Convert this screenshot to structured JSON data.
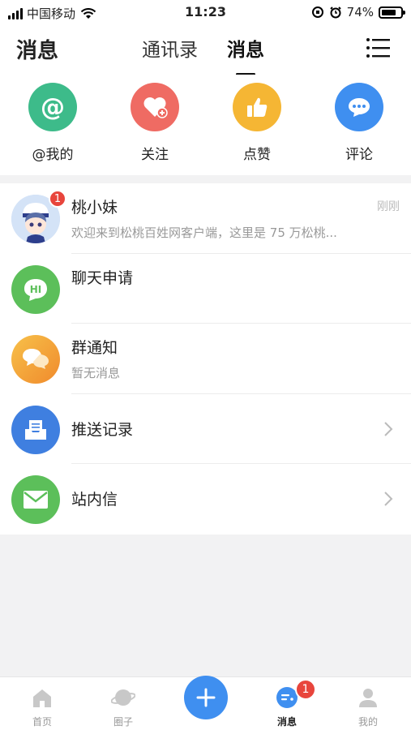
{
  "status_bar": {
    "carrier": "中国移动",
    "time": "11:23",
    "battery": "74%"
  },
  "header": {
    "title": "消息",
    "tabs": [
      {
        "label": "通讯录",
        "active": false
      },
      {
        "label": "消息",
        "active": true
      }
    ]
  },
  "actions": [
    {
      "label": "@我的",
      "icon": "at-icon",
      "color": "#3dbb8a"
    },
    {
      "label": "关注",
      "icon": "heart-plus-icon",
      "color": "#ef6b63"
    },
    {
      "label": "点赞",
      "icon": "thumbs-up-icon",
      "color": "#f5b634"
    },
    {
      "label": "评论",
      "icon": "comment-icon",
      "color": "#3f8ff0"
    }
  ],
  "messages": [
    {
      "name": "桃小妹",
      "preview": "欢迎来到松桃百姓网客户端，这里是 75 万松桃...",
      "time": "刚刚",
      "badge": "1"
    },
    {
      "name": "聊天申请",
      "icon_text": "HI"
    },
    {
      "name": "群通知",
      "preview": "暂无消息"
    },
    {
      "name": "推送记录"
    },
    {
      "name": "站内信"
    }
  ],
  "bottom_nav": [
    {
      "label": "首页"
    },
    {
      "label": "圈子"
    },
    {
      "label": "消息",
      "badge": "1",
      "active": true
    },
    {
      "label": "我的"
    }
  ],
  "colors": {
    "accent": "#3f8ff0",
    "badge": "#e8453c",
    "green": "#5cbf5a"
  }
}
